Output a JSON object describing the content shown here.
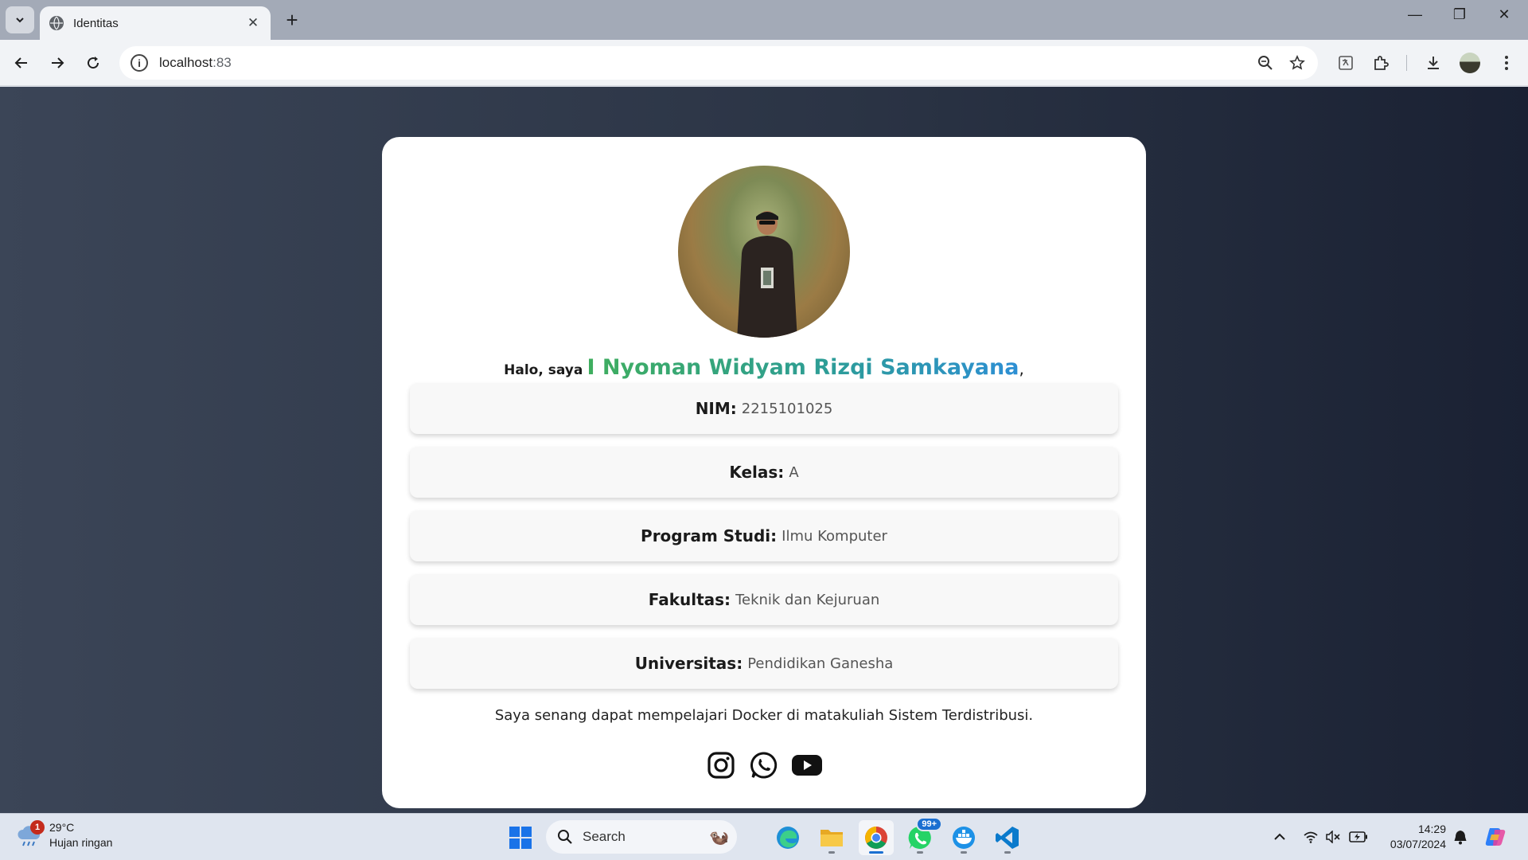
{
  "browser": {
    "tab_title": "Identitas",
    "url_host": "localhost",
    "url_port": ":83"
  },
  "profile": {
    "greeting_prefix": "Halo, saya",
    "name": "I Nyoman Widyam Rizqi Samkayana",
    "name_suffix": ",",
    "items": [
      {
        "label": "NIM:",
        "value": "2215101025"
      },
      {
        "label": "Kelas:",
        "value": "A"
      },
      {
        "label": "Program Studi:",
        "value": "Ilmu Komputer"
      },
      {
        "label": "Fakultas:",
        "value": "Teknik dan Kejuruan"
      },
      {
        "label": "Universitas:",
        "value": "Pendidikan Ganesha"
      }
    ],
    "bio": "Saya senang dapat mempelajari Docker di matakuliah Sistem Terdistribusi.",
    "socials": [
      "instagram-icon",
      "whatsapp-icon",
      "youtube-icon"
    ],
    "name_gradient": [
      "#3fae5e",
      "#2d8fd4"
    ]
  },
  "taskbar": {
    "weather_temp": "29°C",
    "weather_desc": "Hujan ringan",
    "weather_badge": "1",
    "search_label": "Search",
    "whatsapp_badge": "99+",
    "time": "14:29",
    "date": "03/07/2024"
  }
}
